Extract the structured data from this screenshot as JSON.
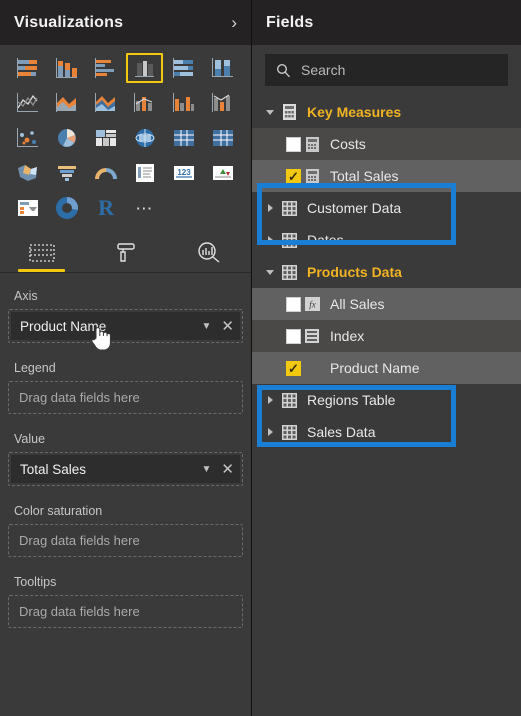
{
  "visualizations": {
    "title": "Visualizations",
    "collapse_icon": "chevron-right-icon",
    "gallery": [
      {
        "name": "stacked-bar-chart",
        "selected": false
      },
      {
        "name": "stacked-column-chart",
        "selected": false
      },
      {
        "name": "clustered-bar-chart",
        "selected": false
      },
      {
        "name": "clustered-column-chart",
        "selected": true
      },
      {
        "name": "100-percent-stacked-bar-chart",
        "selected": false
      },
      {
        "name": "100-percent-stacked-column-chart",
        "selected": false
      },
      {
        "name": "line-chart",
        "selected": false
      },
      {
        "name": "area-chart",
        "selected": false
      },
      {
        "name": "stacked-area-chart",
        "selected": false
      },
      {
        "name": "line-and-stacked-column-chart",
        "selected": false
      },
      {
        "name": "line-and-clustered-column-chart",
        "selected": false
      },
      {
        "name": "ribbon-chart",
        "selected": false
      },
      {
        "name": "scatter-chart",
        "selected": false
      },
      {
        "name": "pie-chart",
        "selected": false
      },
      {
        "name": "treemap",
        "selected": false
      },
      {
        "name": "map",
        "selected": false
      },
      {
        "name": "table",
        "selected": false
      },
      {
        "name": "matrix",
        "selected": false
      },
      {
        "name": "filled-map",
        "selected": false
      },
      {
        "name": "funnel-chart",
        "selected": false
      },
      {
        "name": "gauge-chart",
        "selected": false
      },
      {
        "name": "multi-row-card",
        "selected": false
      },
      {
        "name": "card",
        "selected": false
      },
      {
        "name": "kpi",
        "selected": false
      },
      {
        "name": "slicer",
        "selected": false
      },
      {
        "name": "donut-chart",
        "selected": false
      },
      {
        "name": "r-script-visual",
        "selected": false
      },
      {
        "name": "more-options",
        "selected": false
      }
    ],
    "tabs": [
      {
        "name": "tab-fields",
        "icon": "fields-table-icon",
        "active": true
      },
      {
        "name": "tab-format",
        "icon": "paint-roller-icon",
        "active": false
      },
      {
        "name": "tab-analytics",
        "icon": "magnifier-chart-icon",
        "active": false
      }
    ],
    "wells": [
      {
        "label": "Axis",
        "value": "Product Name",
        "placeholder": "",
        "filled": true
      },
      {
        "label": "Legend",
        "value": "",
        "placeholder": "Drag data fields here",
        "filled": false
      },
      {
        "label": "Value",
        "value": "Total Sales",
        "placeholder": "",
        "filled": true
      },
      {
        "label": "Color saturation",
        "value": "",
        "placeholder": "Drag data fields here",
        "filled": false
      },
      {
        "label": "Tooltips",
        "value": "",
        "placeholder": "Drag data fields here",
        "filled": false
      }
    ]
  },
  "fields": {
    "title": "Fields",
    "search": {
      "placeholder": "Search",
      "value": "",
      "icon": "search-icon"
    },
    "items": [
      {
        "label": "Key Measures",
        "type": "table",
        "icon": "measure-table-icon",
        "expanded": true,
        "accent": true,
        "indent": false,
        "checkbox": null,
        "row_state": "none"
      },
      {
        "label": "Costs",
        "type": "measure",
        "icon": "measure-icon",
        "expanded": null,
        "accent": false,
        "indent": true,
        "checkbox": false,
        "row_state": "subtle"
      },
      {
        "label": "Total Sales",
        "type": "measure",
        "icon": "measure-icon",
        "expanded": null,
        "accent": false,
        "indent": true,
        "checkbox": true,
        "row_state": "highlight"
      },
      {
        "label": "Customer Data",
        "type": "table",
        "icon": "table-icon",
        "expanded": false,
        "accent": false,
        "indent": false,
        "checkbox": null,
        "row_state": "none"
      },
      {
        "label": "Dates",
        "type": "table",
        "icon": "table-icon",
        "expanded": false,
        "accent": false,
        "indent": false,
        "checkbox": null,
        "row_state": "none"
      },
      {
        "label": "Products Data",
        "type": "table",
        "icon": "table-icon",
        "expanded": true,
        "accent": true,
        "indent": false,
        "checkbox": null,
        "row_state": "none"
      },
      {
        "label": "All Sales",
        "type": "measure",
        "icon": "fx-icon",
        "expanded": null,
        "accent": false,
        "indent": true,
        "checkbox": false,
        "row_state": "highlight"
      },
      {
        "label": "Index",
        "type": "column",
        "icon": "column-icon",
        "expanded": null,
        "accent": false,
        "indent": true,
        "checkbox": false,
        "row_state": "subtle"
      },
      {
        "label": "Product Name",
        "type": "column",
        "icon": "column-icon",
        "expanded": null,
        "accent": false,
        "indent": true,
        "checkbox": true,
        "row_state": "highlight"
      },
      {
        "label": "Regions Table",
        "type": "table",
        "icon": "table-icon",
        "expanded": false,
        "accent": false,
        "indent": false,
        "checkbox": null,
        "row_state": "none"
      },
      {
        "label": "Sales Data",
        "type": "table",
        "icon": "table-icon",
        "expanded": false,
        "accent": false,
        "indent": false,
        "checkbox": null,
        "row_state": "none"
      }
    ],
    "annotations": [
      {
        "name": "annotation-total-sales",
        "target": "Total Sales"
      },
      {
        "name": "annotation-product-name",
        "target": "Product Name"
      }
    ]
  },
  "colors": {
    "accent_yellow": "#f2c811",
    "table_accent": "#f0b323",
    "annotation_blue": "#1a7fd4",
    "panel_bg": "#3b3a3a",
    "header_bg": "#242223"
  }
}
